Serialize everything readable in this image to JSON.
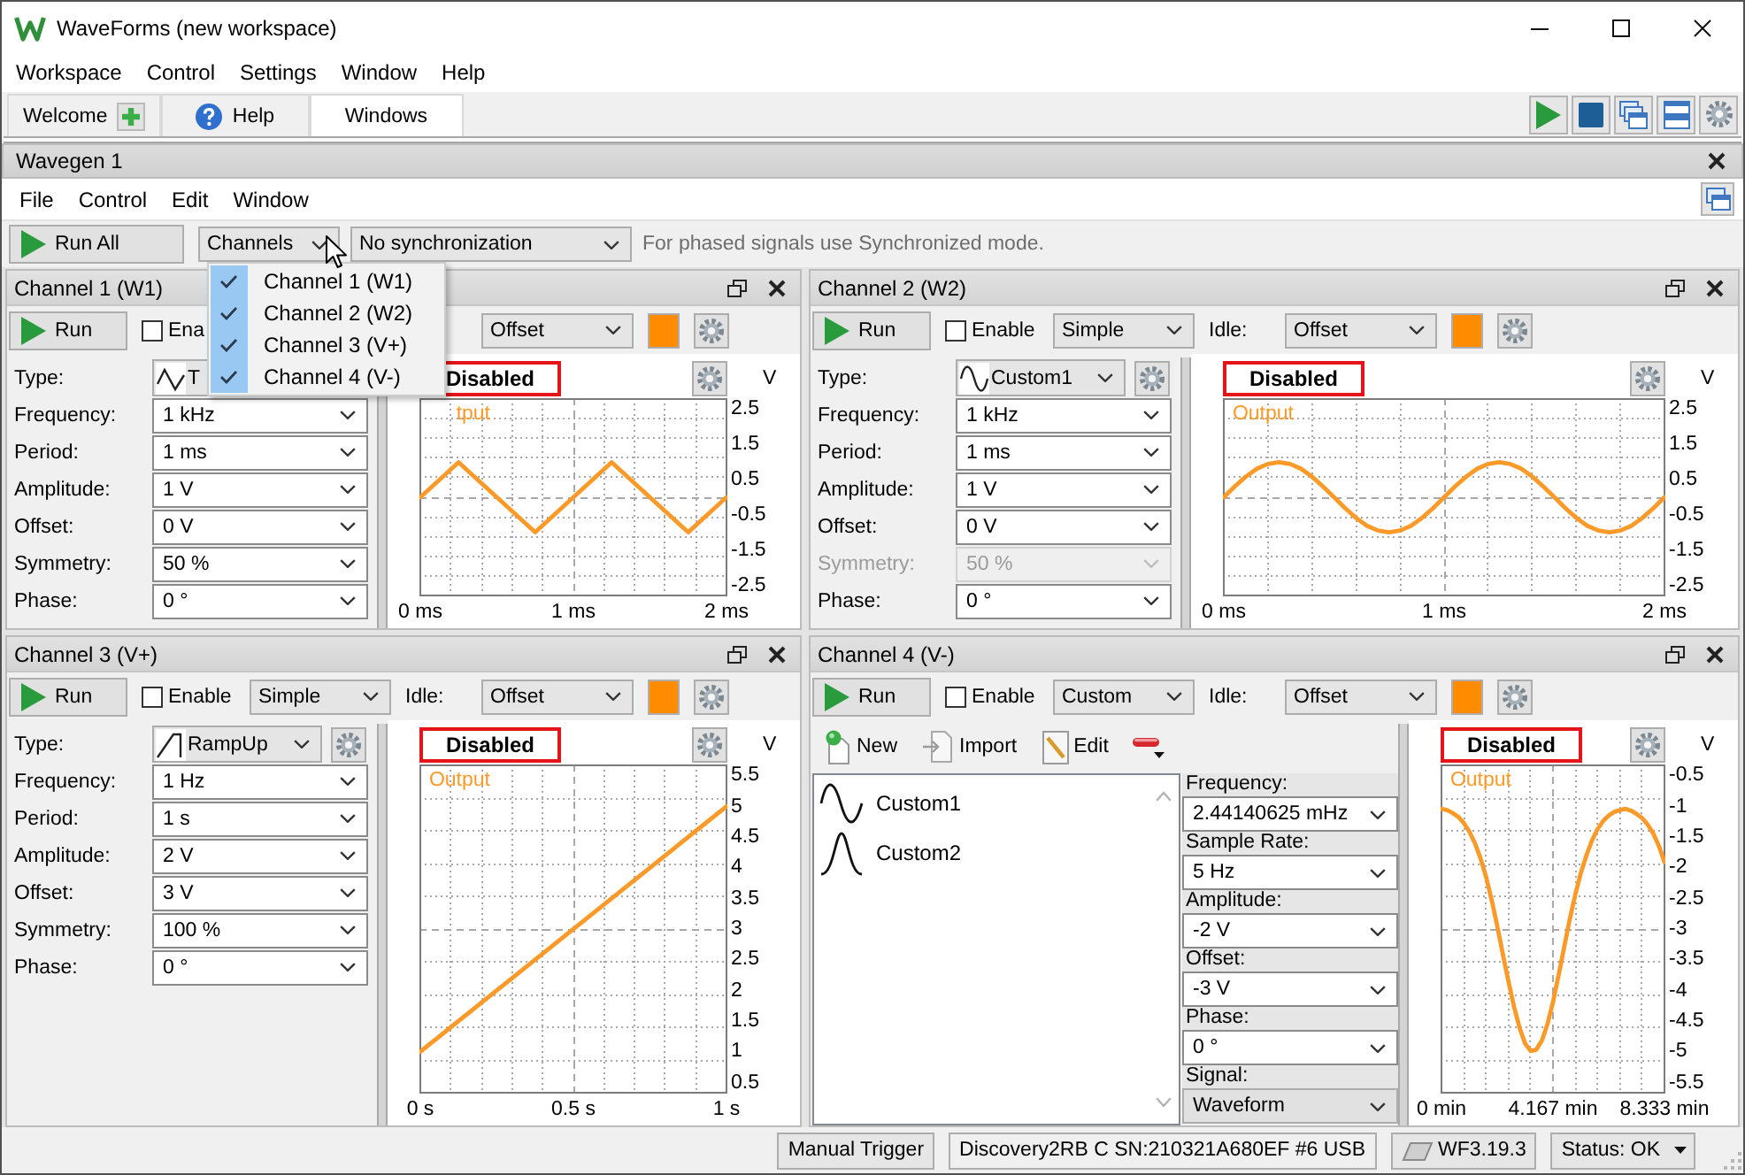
{
  "window": {
    "title": "WaveForms (new workspace)"
  },
  "menu_bar": [
    "Workspace",
    "Control",
    "Settings",
    "Window",
    "Help"
  ],
  "tabs": [
    {
      "label": "Welcome",
      "kind": "welcome",
      "selected": false
    },
    {
      "label": "Help",
      "kind": "help",
      "selected": false
    },
    {
      "label": "Windows",
      "kind": "plain",
      "selected": true
    }
  ],
  "wavegen": {
    "title": "Wavegen 1",
    "menu": [
      "File",
      "Control",
      "Edit",
      "Window"
    ],
    "run_all": "Run All",
    "channels_dropdown": {
      "value": "Channels",
      "expanded": true,
      "options": [
        {
          "label": "Channel 1 (W1)",
          "checked": true
        },
        {
          "label": "Channel 2 (W2)",
          "checked": true
        },
        {
          "label": "Channel 3 (V+)",
          "checked": true
        },
        {
          "label": "Channel 4 (V-)",
          "checked": true
        }
      ]
    },
    "sync_dropdown": {
      "value": "No synchronization"
    },
    "hint": "For phased signals use Synchronized mode."
  },
  "channels": [
    {
      "kind": "simple",
      "title": "Channel 1 (W1)",
      "run": "Run",
      "enable": {
        "label": "Ena",
        "checked": false
      },
      "idle": {
        "value": "Offset"
      },
      "color": "#ff8c00",
      "type": {
        "label": "Type:",
        "value": "T",
        "kind": "triangle"
      },
      "params": [
        {
          "label": "Frequency:",
          "value": "1 kHz",
          "disabled": false
        },
        {
          "label": "Period:",
          "value": "1 ms",
          "disabled": false
        },
        {
          "label": "Amplitude:",
          "value": "1 V",
          "disabled": false
        },
        {
          "label": "Offset:",
          "value": "0 V",
          "disabled": false
        },
        {
          "label": "Symmetry:",
          "value": "50 %",
          "disabled": false
        },
        {
          "label": "Phase:",
          "value": "0 °",
          "disabled": false
        }
      ],
      "plot": {
        "status": "Disabled",
        "chart_data": {
          "type": "line",
          "ylabel": "V",
          "grid": true,
          "x": [
            0,
            0.25,
            0.75,
            1.25,
            1.75,
            2
          ],
          "series": [
            {
              "name": "tput",
              "color": "#fb9a28",
              "values": [
                0,
                1,
                -1,
                1,
                -1,
                0
              ]
            }
          ],
          "xlim": [
            0,
            2
          ],
          "ylim": [
            -2.8,
            2.8
          ],
          "xticks": [
            {
              "value": 0,
              "label": "0 ms"
            },
            {
              "value": 1,
              "label": "1 ms"
            },
            {
              "value": 2,
              "label": "2 ms"
            }
          ],
          "yticks": [
            2.5,
            1.5,
            0.5,
            -0.5,
            -1.5,
            -2.5
          ]
        }
      }
    },
    {
      "kind": "simple",
      "title": "Channel 2 (W2)",
      "run": "Run",
      "enable": {
        "label": "Enable",
        "checked": false
      },
      "mode": {
        "value": "Simple"
      },
      "idle": {
        "label": "Idle:",
        "value": "Offset"
      },
      "color": "#ff8c00",
      "type": {
        "label": "Type:",
        "value": "Custom1",
        "kind": "sine"
      },
      "params": [
        {
          "label": "Frequency:",
          "value": "1 kHz",
          "disabled": false
        },
        {
          "label": "Period:",
          "value": "1 ms",
          "disabled": false
        },
        {
          "label": "Amplitude:",
          "value": "1 V",
          "disabled": false
        },
        {
          "label": "Offset:",
          "value": "0 V",
          "disabled": false
        },
        {
          "label": "Symmetry:",
          "value": "50 %",
          "disabled": true
        },
        {
          "label": "Phase:",
          "value": "0 °",
          "disabled": false
        }
      ],
      "plot": {
        "status": "Disabled",
        "chart_data": {
          "type": "line",
          "ylabel": "V",
          "grid": true,
          "x": [
            0,
            0.05,
            0.1,
            0.15,
            0.2,
            0.25,
            0.3,
            0.35,
            0.4,
            0.45,
            0.5,
            0.55,
            0.6,
            0.65,
            0.7,
            0.75,
            0.8,
            0.85,
            0.9,
            0.95,
            1,
            1.05,
            1.1,
            1.15,
            1.2,
            1.25,
            1.3,
            1.35,
            1.4,
            1.45,
            1.5,
            1.55,
            1.6,
            1.65,
            1.7,
            1.75,
            1.8,
            1.85,
            1.9,
            1.95,
            2
          ],
          "series": [
            {
              "name": "Output",
              "color": "#fb9a28",
              "values": [
                0,
                0.31,
                0.59,
                0.81,
                0.95,
                1,
                0.95,
                0.81,
                0.59,
                0.31,
                0,
                -0.31,
                -0.59,
                -0.81,
                -0.95,
                -1,
                -0.95,
                -0.81,
                -0.59,
                -0.31,
                0,
                0.31,
                0.59,
                0.81,
                0.95,
                1,
                0.95,
                0.81,
                0.59,
                0.31,
                0,
                -0.31,
                -0.59,
                -0.81,
                -0.95,
                -1,
                -0.95,
                -0.81,
                -0.59,
                -0.31,
                0
              ]
            }
          ],
          "xlim": [
            0,
            2
          ],
          "ylim": [
            -2.8,
            2.8
          ],
          "xticks": [
            {
              "value": 0,
              "label": "0 ms"
            },
            {
              "value": 1,
              "label": "1 ms"
            },
            {
              "value": 2,
              "label": "2 ms"
            }
          ],
          "yticks": [
            2.5,
            1.5,
            0.5,
            -0.5,
            -1.5,
            -2.5
          ]
        }
      }
    },
    {
      "kind": "simple",
      "title": "Channel 3 (V+)",
      "run": "Run",
      "enable": {
        "label": "Enable",
        "checked": false
      },
      "mode": {
        "value": "Simple"
      },
      "idle": {
        "label": "Idle:",
        "value": "Offset"
      },
      "color": "#ff8c00",
      "type": {
        "label": "Type:",
        "value": "RampUp",
        "kind": "ramp"
      },
      "params": [
        {
          "label": "Frequency:",
          "value": "1 Hz",
          "disabled": false
        },
        {
          "label": "Period:",
          "value": "1 s",
          "disabled": false
        },
        {
          "label": "Amplitude:",
          "value": "2 V",
          "disabled": false
        },
        {
          "label": "Offset:",
          "value": "3 V",
          "disabled": false
        },
        {
          "label": "Symmetry:",
          "value": "100 %",
          "disabled": false
        },
        {
          "label": "Phase:",
          "value": "0 °",
          "disabled": false
        }
      ],
      "plot": {
        "status": "Disabled",
        "chart_data": {
          "type": "line",
          "ylabel": "V",
          "grid": true,
          "x": [
            0,
            1
          ],
          "series": [
            {
              "name": "Output",
              "color": "#fb9a28",
              "values": [
                1,
                5
              ]
            }
          ],
          "xlim": [
            0,
            1
          ],
          "ylim": [
            0.33,
            5.67
          ],
          "xticks": [
            {
              "value": 0,
              "label": "0 s"
            },
            {
              "value": 0.5,
              "label": "0.5 s"
            },
            {
              "value": 1,
              "label": "1 s"
            }
          ],
          "yticks": [
            5.5,
            5,
            4.5,
            4,
            3.5,
            3,
            2.5,
            2,
            1.5,
            1,
            0.5
          ]
        }
      }
    },
    {
      "kind": "custom",
      "title": "Channel 4 (V-)",
      "run": "Run",
      "enable": {
        "label": "Enable",
        "checked": false
      },
      "mode": {
        "value": "Custom"
      },
      "idle": {
        "label": "Idle:",
        "value": "Offset"
      },
      "color": "#ff8c00",
      "tools": [
        {
          "kind": "new",
          "label": "New"
        },
        {
          "kind": "import",
          "label": "Import"
        },
        {
          "kind": "edit",
          "label": "Edit"
        },
        {
          "kind": "menu"
        }
      ],
      "waveforms": [
        {
          "label": "Custom1",
          "kind": "sine",
          "selected": false
        },
        {
          "label": "Custom2",
          "kind": "pulse",
          "selected": false
        }
      ],
      "params": [
        {
          "label": "Frequency:",
          "value": "2.44140625 mHz",
          "kind": "input"
        },
        {
          "label": "Sample Rate:",
          "value": "5 Hz",
          "kind": "input"
        },
        {
          "label": "Amplitude:",
          "value": "-2 V",
          "kind": "input"
        },
        {
          "label": "Offset:",
          "value": "-3 V",
          "kind": "input"
        },
        {
          "label": "Phase:",
          "value": "0 °",
          "kind": "input"
        },
        {
          "label": "Signal:",
          "value": "Waveform",
          "kind": "select"
        }
      ],
      "plot": {
        "status": "Disabled",
        "chart_data": {
          "type": "line",
          "ylabel": "V",
          "grid": true,
          "x": [
            0,
            0.21,
            0.42,
            0.63,
            0.83,
            1.04,
            1.25,
            1.46,
            1.67,
            1.88,
            2.08,
            2.29,
            2.5,
            2.71,
            2.92,
            3.13,
            3.33,
            3.54,
            3.75,
            3.96,
            4.17,
            4.38,
            4.58,
            4.79,
            5,
            5.21,
            5.42,
            5.63,
            5.83,
            6.04,
            6.25,
            6.46,
            6.67,
            6.88,
            7.08,
            7.29,
            7.5,
            7.71,
            7.92,
            8.13,
            8.33
          ],
          "series": [
            {
              "name": "Output",
              "color": "#fb9a28",
              "values": [
                -1.04,
                -1.06,
                -1.11,
                -1.17,
                -1.27,
                -1.41,
                -1.6,
                -1.85,
                -2.16,
                -2.53,
                -2.95,
                -3.4,
                -3.85,
                -4.27,
                -4.62,
                -4.87,
                -4.99,
                -4.97,
                -4.82,
                -4.55,
                -4.18,
                -3.75,
                -3.3,
                -2.85,
                -2.44,
                -2.08,
                -1.79,
                -1.55,
                -1.37,
                -1.24,
                -1.15,
                -1.09,
                -1.06,
                -1.04,
                -1.07,
                -1.12,
                -1.19,
                -1.3,
                -1.45,
                -1.65,
                -1.91
              ]
            }
          ],
          "xlim": [
            0,
            8.333
          ],
          "ylim": [
            -5.67,
            -0.33
          ],
          "xticks": [
            {
              "value": 0,
              "label": "0 min"
            },
            {
              "value": 4.167,
              "label": "4.167 min"
            },
            {
              "value": 8.333,
              "label": "8.333 min"
            }
          ],
          "yticks": [
            -0.5,
            -1,
            -1.5,
            -2,
            -2.5,
            -3,
            -3.5,
            -4,
            -4.5,
            -5,
            -5.5
          ]
        }
      }
    }
  ],
  "status_bar": {
    "trigger": "Manual Trigger",
    "device": "Discovery2RB C SN:210321A680EF #6 USB",
    "version": "WF3.19.3",
    "status": "Status: OK"
  }
}
